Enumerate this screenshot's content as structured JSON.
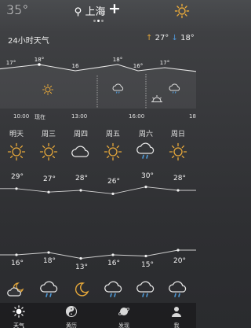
{
  "status": {
    "current_temp": "35°",
    "city": "上海",
    "page_dots": 3,
    "page_dot_active": 1
  },
  "hourly": {
    "title": "24小时天气",
    "high": "27°",
    "low": "18°",
    "time_labels": [
      "10:00",
      "现在",
      "13:00",
      "16:00",
      "18"
    ],
    "temps": [
      {
        "label": "17°",
        "value": 17
      },
      {
        "label": "18°",
        "value": 18
      },
      {
        "label": "16",
        "value": 16
      },
      {
        "label": "18°",
        "value": 18
      },
      {
        "label": "16°",
        "value": 16
      },
      {
        "label": "17°",
        "value": 17
      }
    ],
    "icons": [
      "sun-icon",
      "rain-icon",
      "sunset-icon"
    ]
  },
  "week": {
    "days": [
      {
        "name": "明天",
        "day_icon": "sun-icon",
        "high": "29°",
        "low": "16°",
        "night_icon": "moon-cloud-icon"
      },
      {
        "name": "周三",
        "day_icon": "sun-icon",
        "high": "27°",
        "low": "18°",
        "night_icon": "rain-icon"
      },
      {
        "name": "周四",
        "day_icon": "cloud-icon",
        "high": "28°",
        "low": "13°",
        "night_icon": "moon-icon"
      },
      {
        "name": "周五",
        "day_icon": "sun-icon",
        "high": "26°",
        "low": "16°",
        "night_icon": "rain-icon"
      },
      {
        "name": "周六",
        "day_icon": "rain-icon",
        "high": "30°",
        "low": "15°",
        "night_icon": "rain-icon"
      },
      {
        "name": "周日",
        "day_icon": "sun-icon",
        "high": "28°",
        "low": "20°",
        "night_icon": "rain-icon"
      }
    ]
  },
  "nav": {
    "items": [
      {
        "label": "天气",
        "icon": "sun-icon",
        "active": true
      },
      {
        "label": "黄历",
        "icon": "yin-yang-icon",
        "active": false
      },
      {
        "label": "发现",
        "icon": "planet-icon",
        "active": false
      },
      {
        "label": "我",
        "icon": "user-icon",
        "active": false
      }
    ]
  },
  "colors": {
    "sun": "#e8a93a",
    "rain": "#4e9ad8",
    "high_arrow": "#e2a63a",
    "low_arrow": "#4e95d6"
  }
}
